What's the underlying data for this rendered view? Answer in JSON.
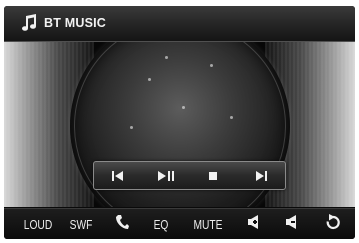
{
  "header": {
    "title": "BT MUSIC",
    "icon": "music-note-icon"
  },
  "transport": {
    "buttons": [
      {
        "name": "previous-track-button",
        "icon": "skip-back-icon"
      },
      {
        "name": "play-pause-button",
        "icon": "play-pause-icon"
      },
      {
        "name": "stop-button",
        "icon": "stop-icon"
      },
      {
        "name": "next-track-button",
        "icon": "skip-forward-icon"
      }
    ]
  },
  "bottom_bar": {
    "loud_label": "LOUD",
    "swf_label": "SWF",
    "phone_icon": "phone-icon",
    "eq_label": "EQ",
    "mute_label": "MUTE",
    "volume_up_icon": "volume-up-icon",
    "volume_down_icon": "volume-down-icon",
    "back_icon": "back-arrow-icon"
  },
  "colors": {
    "background": "#0a0a0a",
    "text": "#ececec",
    "panel_border": "#8a8a8a"
  }
}
